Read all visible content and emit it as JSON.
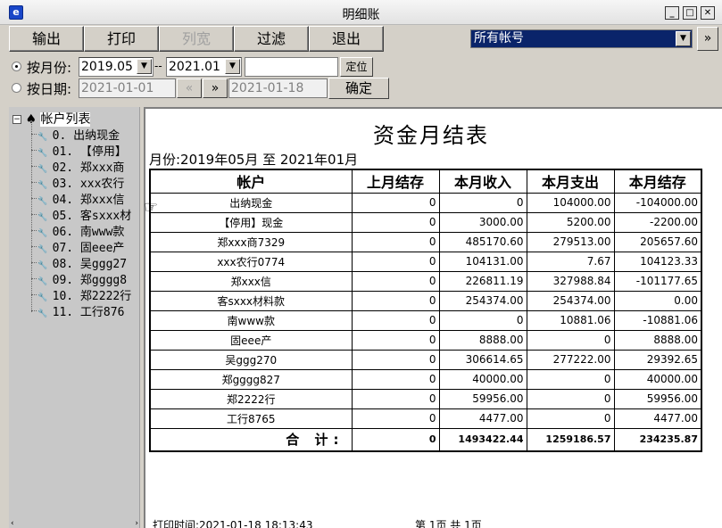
{
  "window": {
    "title": "明细账",
    "min_label": "_",
    "max_label": "□",
    "close_label": "✕"
  },
  "toolbar": {
    "buttons": [
      "输出",
      "打印",
      "列宽",
      "过滤",
      "退出"
    ],
    "account_filter": "所有帐号",
    "more_label": "»"
  },
  "filters": {
    "by_month_label": "按月份:",
    "month_from": "2019.05",
    "month_sep": "--",
    "month_to": "2021.01",
    "locate_label": "定位",
    "by_date_label": "按日期:",
    "date_from": "2021-01-01",
    "prev_label": "«",
    "next_label": "»",
    "date_to": "2021-01-18",
    "confirm_label": "确定"
  },
  "tree": {
    "root_label": "帐户列表",
    "items": [
      "0. 出纳现金",
      "01. 【停用】",
      "02. 郑xxx商",
      "03. xxx农行",
      "04. 郑xxx信",
      "05. 客sxxx材",
      "06. 南www款",
      "07. 固eee产",
      "08. 吴ggg27",
      "09. 郑gggg8",
      "10. 郑2222行",
      "11. 工行876"
    ]
  },
  "report": {
    "title": "资金月结表",
    "period": "月份:2019年05月 至 2021年01月",
    "columns": [
      "帐户",
      "上月结存",
      "本月收入",
      "本月支出",
      "本月结存"
    ],
    "rows": [
      [
        "出纳现金",
        "0",
        "0",
        "104000.00",
        "-104000.00"
      ],
      [
        "【停用】现金",
        "0",
        "3000.00",
        "5200.00",
        "-2200.00"
      ],
      [
        "郑xxx商7329",
        "0",
        "485170.60",
        "279513.00",
        "205657.60"
      ],
      [
        "xxx农行0774",
        "0",
        "104131.00",
        "7.67",
        "104123.33"
      ],
      [
        "郑xxx信",
        "0",
        "226811.19",
        "327988.84",
        "-101177.65"
      ],
      [
        "客sxxx材料款",
        "0",
        "254374.00",
        "254374.00",
        "0.00"
      ],
      [
        "南www款",
        "0",
        "0",
        "10881.06",
        "-10881.06"
      ],
      [
        "固eee产",
        "0",
        "8888.00",
        "0",
        "8888.00"
      ],
      [
        "吴ggg270",
        "0",
        "306614.65",
        "277222.00",
        "29392.65"
      ],
      [
        "郑gggg827",
        "0",
        "40000.00",
        "0",
        "40000.00"
      ],
      [
        "郑2222行",
        "0",
        "59956.00",
        "0",
        "59956.00"
      ],
      [
        "工行8765",
        "0",
        "4477.00",
        "0",
        "4477.00"
      ]
    ],
    "total": [
      "合 计:",
      "0",
      "1493422.44",
      "1259186.57",
      "234235.87"
    ],
    "print_time": "打印时间:2021-01-18 18:13:43",
    "page_info": "第 1页  共 1页"
  }
}
